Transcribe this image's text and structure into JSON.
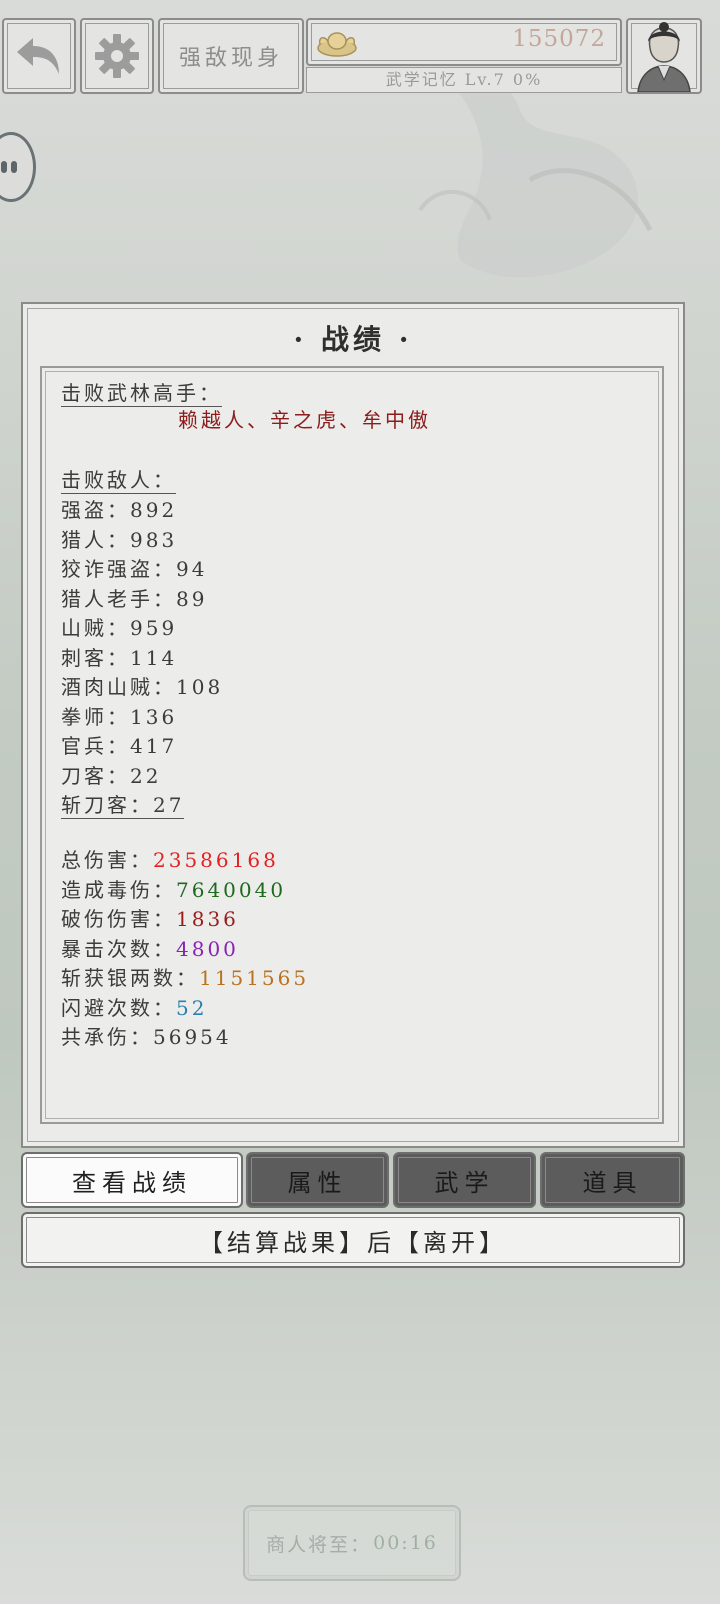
{
  "header": {
    "title": "强敌现身",
    "coins": "155072",
    "level": "武学记忆 Lv.7 0%"
  },
  "panel": {
    "title": "· 战绩 ·",
    "masters_label": "击败武林高手：",
    "masters": "赖越人、辛之虎、牟中傲",
    "enemies_label": "击败敌人：",
    "enemies": [
      {
        "name": "强盗",
        "count": "892"
      },
      {
        "name": "猎人",
        "count": "983"
      },
      {
        "name": "狡诈强盗",
        "count": "94"
      },
      {
        "name": "猎人老手",
        "count": "89"
      },
      {
        "name": "山贼",
        "count": "959"
      },
      {
        "name": "刺客",
        "count": "114"
      },
      {
        "name": "酒肉山贼",
        "count": "108"
      },
      {
        "name": "拳师",
        "count": "136"
      },
      {
        "name": "官兵",
        "count": "417"
      },
      {
        "name": "刀客",
        "count": "22"
      },
      {
        "name": "斩刀客",
        "count": "27"
      }
    ],
    "stats": [
      {
        "label": "总伤害",
        "value": "23586168",
        "color": "#e02323"
      },
      {
        "label": "造成毒伤",
        "value": "7640040",
        "color": "#1f6a1f"
      },
      {
        "label": "破伤伤害",
        "value": "1836",
        "color": "#9a1d1d"
      },
      {
        "label": "暴击次数",
        "value": "4800",
        "color": "#8b22b8"
      },
      {
        "label": "斩获银两数",
        "value": "1151565",
        "color": "#b9721f"
      },
      {
        "label": "闪避次数",
        "value": "52",
        "color": "#2a7fb0"
      },
      {
        "label": "共承伤",
        "value": "56954",
        "color": "#3c3c3c"
      }
    ]
  },
  "tabs": [
    "查看战绩",
    "属性",
    "武学",
    "道具"
  ],
  "settle_button": "【结算战果】后【离开】",
  "merchant": {
    "label": "商人将至：",
    "time": "00:16"
  }
}
